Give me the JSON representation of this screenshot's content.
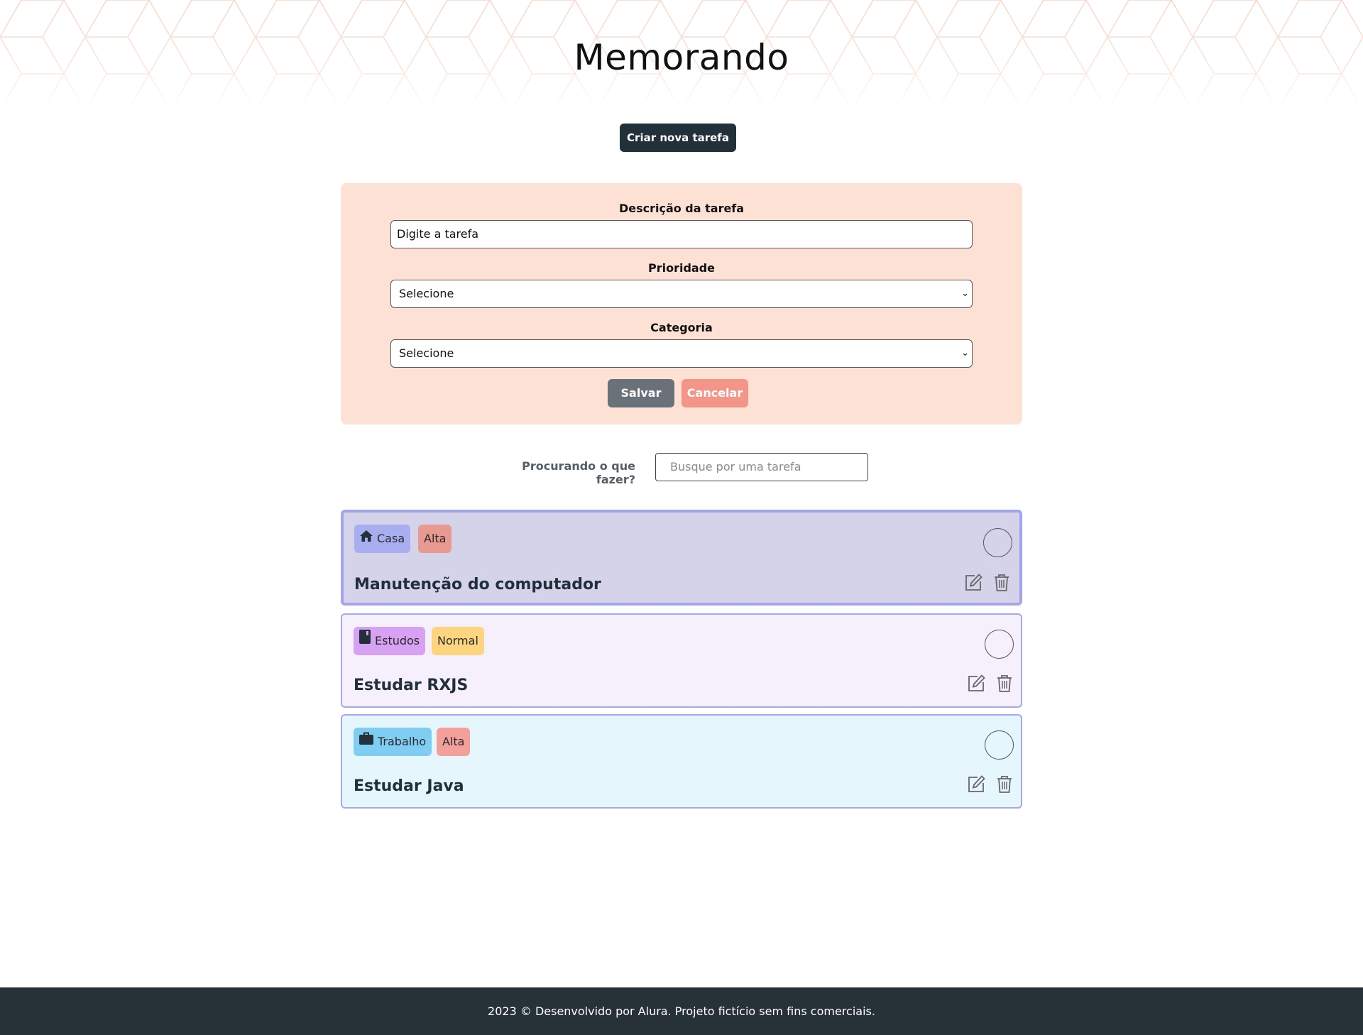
{
  "header": {
    "title": "Memorando"
  },
  "actions": {
    "new_task_label": "Criar nova tarefa"
  },
  "form": {
    "description_label": "Descrição da tarefa",
    "description_placeholder": "Digite a tarefa",
    "priority_label": "Prioridade",
    "priority_value": "Selecione",
    "category_label": "Categoria",
    "category_value": "Selecione",
    "save_label": "Salvar",
    "cancel_label": "Cancelar"
  },
  "search": {
    "label": "Procurando o que fazer?",
    "placeholder": "Busque por uma tarefa"
  },
  "tasks": [
    {
      "category": "Casa",
      "category_icon": "home-icon",
      "category_color": "#a8aef0",
      "priority": "Alta",
      "priority_color": "#e89a90",
      "title": "Manutenção do computador",
      "background": "#d4d3ea",
      "completed": false
    },
    {
      "category": "Estudos",
      "category_icon": "book-icon",
      "category_color": "#d8a2f4",
      "priority": "Normal",
      "priority_color": "#fdd580",
      "title": "Estudar RXJS",
      "background": "#f6effc",
      "completed": false
    },
    {
      "category": "Trabalho",
      "category_icon": "briefcase-icon",
      "category_color": "#80cdf3",
      "priority": "Alta",
      "priority_color": "#f4a09a",
      "title": "Estudar Java",
      "background": "#e6f6fd",
      "completed": false
    }
  ],
  "footer": {
    "text": "2023 © Desenvolvido por Alura. Projeto fictício sem fins comerciais."
  },
  "colors": {
    "dark": "#22303a",
    "form_panel": "#fde1d5",
    "card_border": "#a7a9f0",
    "footer_bg": "#263238"
  }
}
